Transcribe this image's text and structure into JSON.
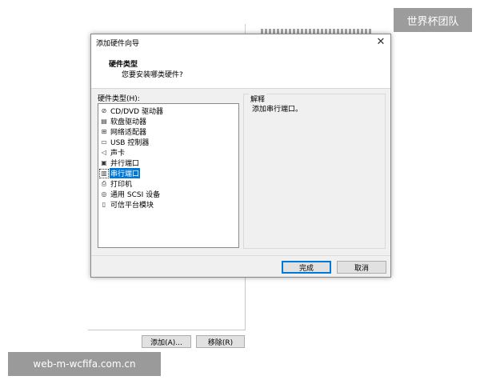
{
  "background": {
    "add_button_label": "添加(A)...",
    "remove_button_label": "移除(R)"
  },
  "watermarks": {
    "top_right": "世界杯团队",
    "bottom_left": "web-m-wcfifa.com.cn"
  },
  "dialog": {
    "title": "添加硬件向导",
    "header": {
      "title": "硬件类型",
      "subtitle": "您要安装哪类硬件?"
    },
    "hardware_label": "硬件类型(H):",
    "hardware_items": [
      {
        "label": "CD/DVD 驱动器",
        "icon": "disc-icon"
      },
      {
        "label": "软盘驱动器",
        "icon": "floppy-icon"
      },
      {
        "label": "网络适配器",
        "icon": "network-icon"
      },
      {
        "label": "USB 控制器",
        "icon": "usb-icon"
      },
      {
        "label": "声卡",
        "icon": "speaker-icon"
      },
      {
        "label": "并行端口",
        "icon": "parallel-port-icon"
      },
      {
        "label": "串行端口",
        "icon": "serial-port-icon"
      },
      {
        "label": "打印机",
        "icon": "printer-icon"
      },
      {
        "label": "通用 SCSI 设备",
        "icon": "scsi-icon"
      },
      {
        "label": "可信平台模块",
        "icon": "tpm-icon"
      }
    ],
    "selected_index": 6,
    "description": {
      "title": "解释",
      "text": "添加串行端口。"
    },
    "finish_label": "完成",
    "cancel_label": "取消"
  },
  "colors": {
    "selection": "#0078d7",
    "dialog_body": "#f0f0f0"
  }
}
